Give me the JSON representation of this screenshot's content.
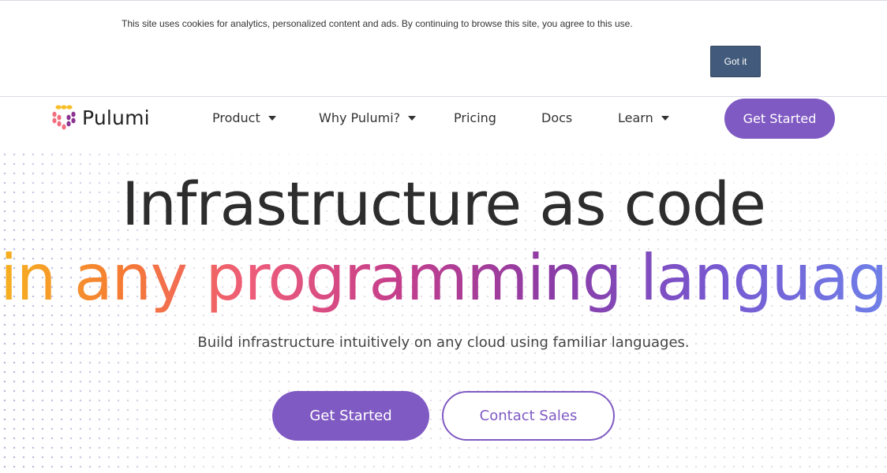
{
  "cookie_banner": {
    "text": "This site uses cookies for analytics, personalized content and ads. By continuing to browse this site, you agree to this use.",
    "button_label": "Got it"
  },
  "nav": {
    "brand": "Pulumi",
    "items": [
      {
        "label": "Product",
        "has_dropdown": true
      },
      {
        "label": "Why Pulumi?",
        "has_dropdown": true
      },
      {
        "label": "Pricing",
        "has_dropdown": false
      },
      {
        "label": "Docs",
        "has_dropdown": false
      },
      {
        "label": "Learn",
        "has_dropdown": true
      }
    ],
    "cta_label": "Get Started"
  },
  "hero": {
    "headline_line1": "Infrastructure as code",
    "headline_line2": "in any programming language",
    "subheadline": "Build infrastructure intuitively on any cloud using familiar languages.",
    "primary_button": "Get Started",
    "secondary_button": "Contact Sales"
  },
  "colors": {
    "brand_purple": "#805ac3",
    "cookie_button": "#425a7b",
    "gradient": [
      "#f6b21f",
      "#f57a35",
      "#ee5c79",
      "#c43e8c",
      "#8c3ca5",
      "#7857cf",
      "#6f80e8"
    ]
  },
  "icons": {
    "logo": "pulumi-logo-icon",
    "dropdown": "caret-down-icon"
  }
}
